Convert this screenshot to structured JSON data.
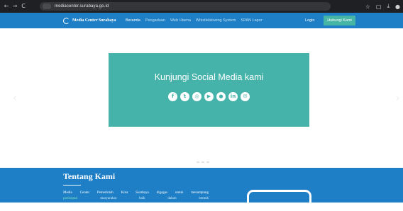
{
  "browser": {
    "url": "mediacenter.surabaya.go.id",
    "back_icon": "←",
    "forward_icon": "→",
    "reload_icon": "C",
    "star_icon": "☆",
    "sidebar_icon": "▢",
    "download_icon": "⤓",
    "profile_icon": "●"
  },
  "navbar": {
    "brand": "Media Center Surabaya",
    "menu": [
      "Beranda",
      "Pengaduan",
      "Web Utama",
      "Whistleblowing System",
      "SPAN Lapor"
    ],
    "login": "Login",
    "contact": "Hubungi Kami",
    "accent_color": "#1e7fc6",
    "button_color": "#45b6a6"
  },
  "hero": {
    "title": "Kunjungi Social Media kami",
    "prev_arrow": "‹",
    "next_arrow": "›",
    "social_icons": [
      "f",
      "t",
      "◎",
      "▶",
      "●",
      "in",
      "✉"
    ],
    "banner_color": "#45b3a9"
  },
  "about": {
    "title": "Tentang Kami",
    "line1": "Media Center Pemerintah Kota Surabaya digagas untuk menampung",
    "line2_highlight": "partisipasi",
    "line2_rest": "masyarakat baik dalam bentuk"
  }
}
